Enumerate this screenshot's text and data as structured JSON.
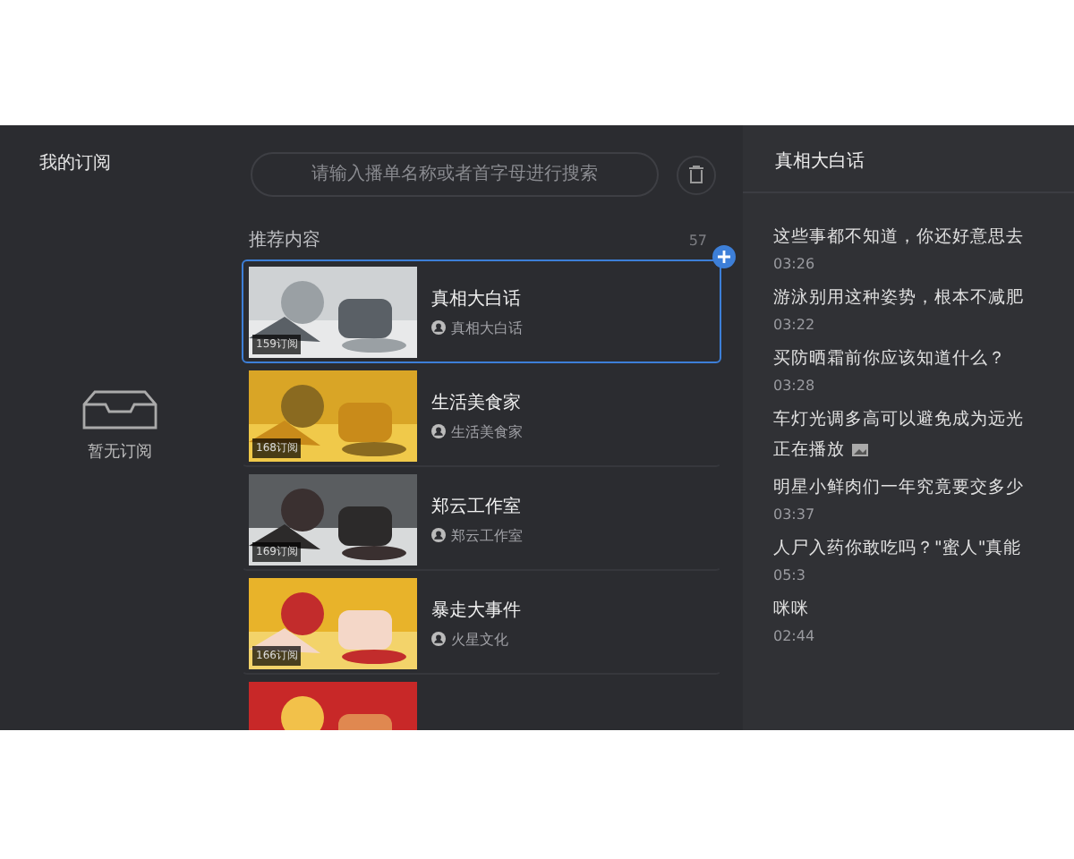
{
  "sidebar": {
    "title": "我的订阅",
    "empty_text": "暂无订阅"
  },
  "search": {
    "placeholder": "请输入播单名称或者首字母进行搜索"
  },
  "recommended": {
    "title": "推荐内容",
    "count": "57",
    "items": [
      {
        "title": "真相大白话",
        "author": "真相大白话",
        "subs": "159订阅",
        "selected": true
      },
      {
        "title": "生活美食家",
        "author": "生活美食家",
        "subs": "168订阅",
        "selected": false
      },
      {
        "title": "郑云工作室",
        "author": "郑云工作室",
        "subs": "169订阅",
        "selected": false
      },
      {
        "title": "暴走大事件",
        "author": "火星文化",
        "subs": "166订阅",
        "selected": false
      },
      {
        "kind": "partial",
        "selected": false
      }
    ]
  },
  "playlist": {
    "title": "真相大白话",
    "items": [
      {
        "title": "这些事都不知道，你还好意思去",
        "meta": "03:26",
        "playing": false
      },
      {
        "title": "游泳别用这种姿势，根本不减肥",
        "meta": "03:22",
        "playing": false
      },
      {
        "title": "买防晒霜前你应该知道什么？",
        "meta": "03:28",
        "playing": false
      },
      {
        "title": "车灯光调多高可以避免成为远光",
        "meta": "正在播放",
        "playing": true
      },
      {
        "title": "明星小鲜肉们一年究竟要交多少",
        "meta": "03:37",
        "playing": false
      },
      {
        "title": "人尸入药你敢吃吗？\"蜜人\"真能",
        "meta": "05:3",
        "playing": false
      },
      {
        "title": "咪咪",
        "meta": "02:44",
        "playing": false
      }
    ]
  }
}
